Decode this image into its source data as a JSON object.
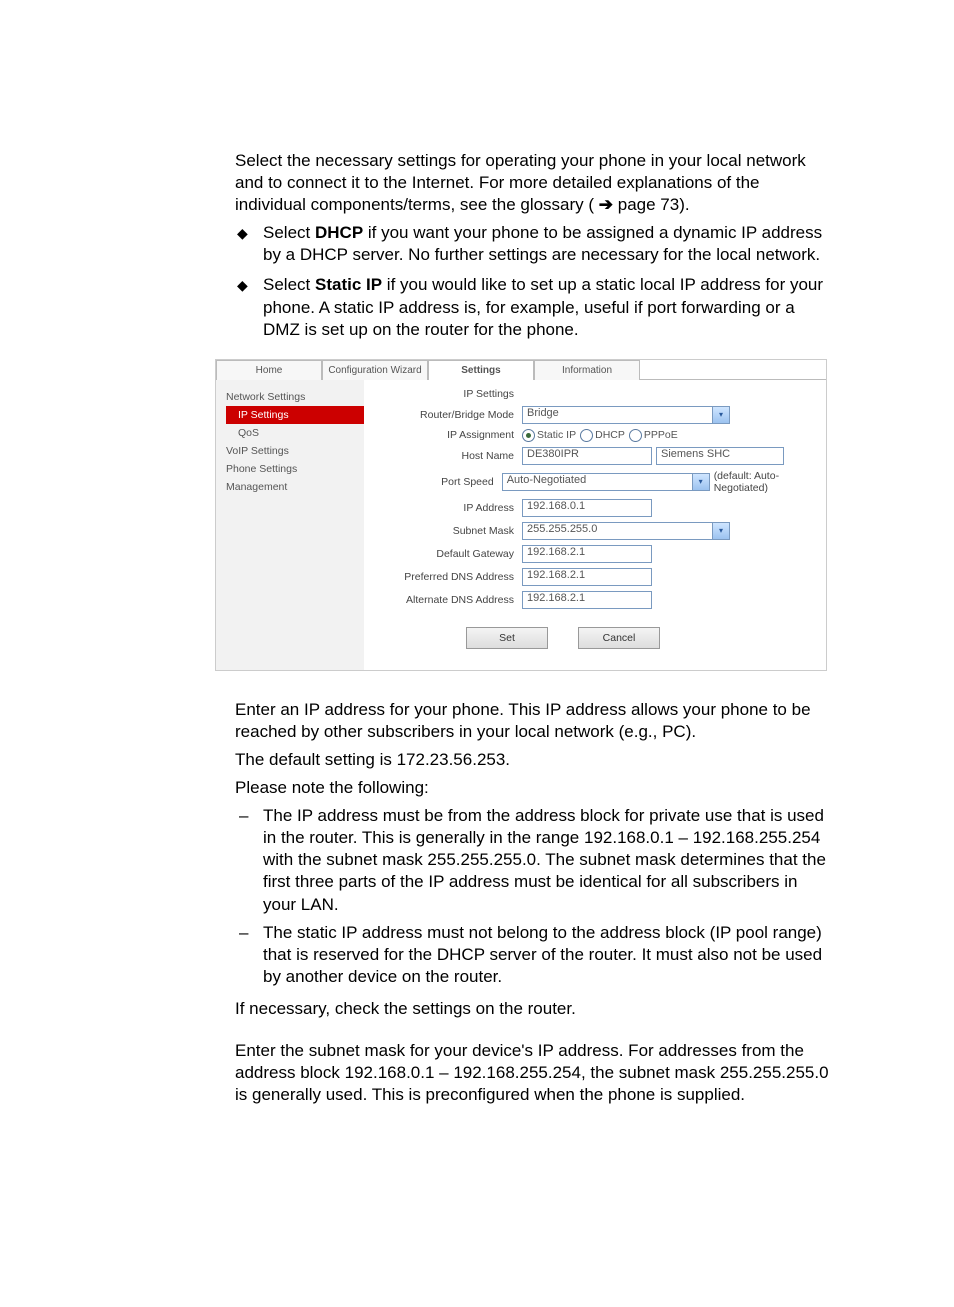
{
  "intro": {
    "p1": "Select the necessary settings for operating your phone in your local network and to connect it to the Internet. For more detailed explanations of the individual components/terms, see the glossary (",
    "arrow": "➔",
    "page_ref": " page 73).",
    "b1_pre": "Select ",
    "b1_bold": "DHCP",
    "b1_post": " if you want your phone to be assigned a dynamic IP address by a DHCP server. No further settings are necessary for the local network.",
    "b2_pre": "Select ",
    "b2_bold": "Static IP",
    "b2_post": " if you would like to set up a static local IP address for your phone. A static IP address is, for example, useful if port forwarding or a DMZ is set up on the router for the phone."
  },
  "screenshot": {
    "tabs": {
      "home": "Home",
      "wizard": "Configuration Wizard",
      "settings": "Settings",
      "info": "Information"
    },
    "sidebar": {
      "network": "Network Settings",
      "ip": "IP Settings",
      "qos": "QoS",
      "voip": "VoIP Settings",
      "phone": "Phone Settings",
      "mgmt": "Management"
    },
    "form": {
      "title": "IP Settings",
      "rb_mode_label": "Router/Bridge Mode",
      "rb_mode_value": "Bridge",
      "ip_assign_label": "IP Assignment",
      "radios": {
        "static": "Static IP",
        "dhcp": "DHCP",
        "pppoe": "PPPoE"
      },
      "host_label": "Host Name",
      "host_value": "DE380IPR",
      "host_suffix": "Siemens SHC",
      "port_label": "Port Speed",
      "port_value": "Auto-Negotiated",
      "port_suffix": "(default: Auto-Negotiated)",
      "ip_label": "IP Address",
      "ip_value": "192.168.0.1",
      "mask_label": "Subnet Mask",
      "mask_value": "255.255.255.0",
      "gw_label": "Default Gateway",
      "gw_value": "192.168.2.1",
      "dns1_label": "Preferred DNS Address",
      "dns1_value": "192.168.2.1",
      "dns2_label": "Alternate DNS Address",
      "dns2_value": "192.168.2.1",
      "set_btn": "Set",
      "cancel_btn": "Cancel"
    }
  },
  "after": {
    "p2": "Enter an IP address for your phone. This IP address allows your phone to be reached by other subscribers in your local network (e.g., PC).",
    "p3": "The default setting is 172.23.56.253.",
    "p4": "Please note the following:",
    "d1": "The IP address must be from the address block for private use that is used in the router. This is generally in the range 192.168.0.1 – 192.168.255.254 with the subnet mask 255.255.255.0. The subnet mask determines that the first three parts of the IP address must be identical for all subscribers in your LAN.",
    "d2": "The static IP address must not belong to the address block (IP pool range) that is reserved for the DHCP server of the router. It must also not be used by another device on the router.",
    "p5": "If necessary, check the settings on the router.",
    "p6": "Enter the subnet mask for your device's IP address. For addresses from the address block 192.168.0.1 – 192.168.255.254, the subnet mask 255.255.255.0 is generally used. This is preconfigured when the phone is supplied."
  }
}
